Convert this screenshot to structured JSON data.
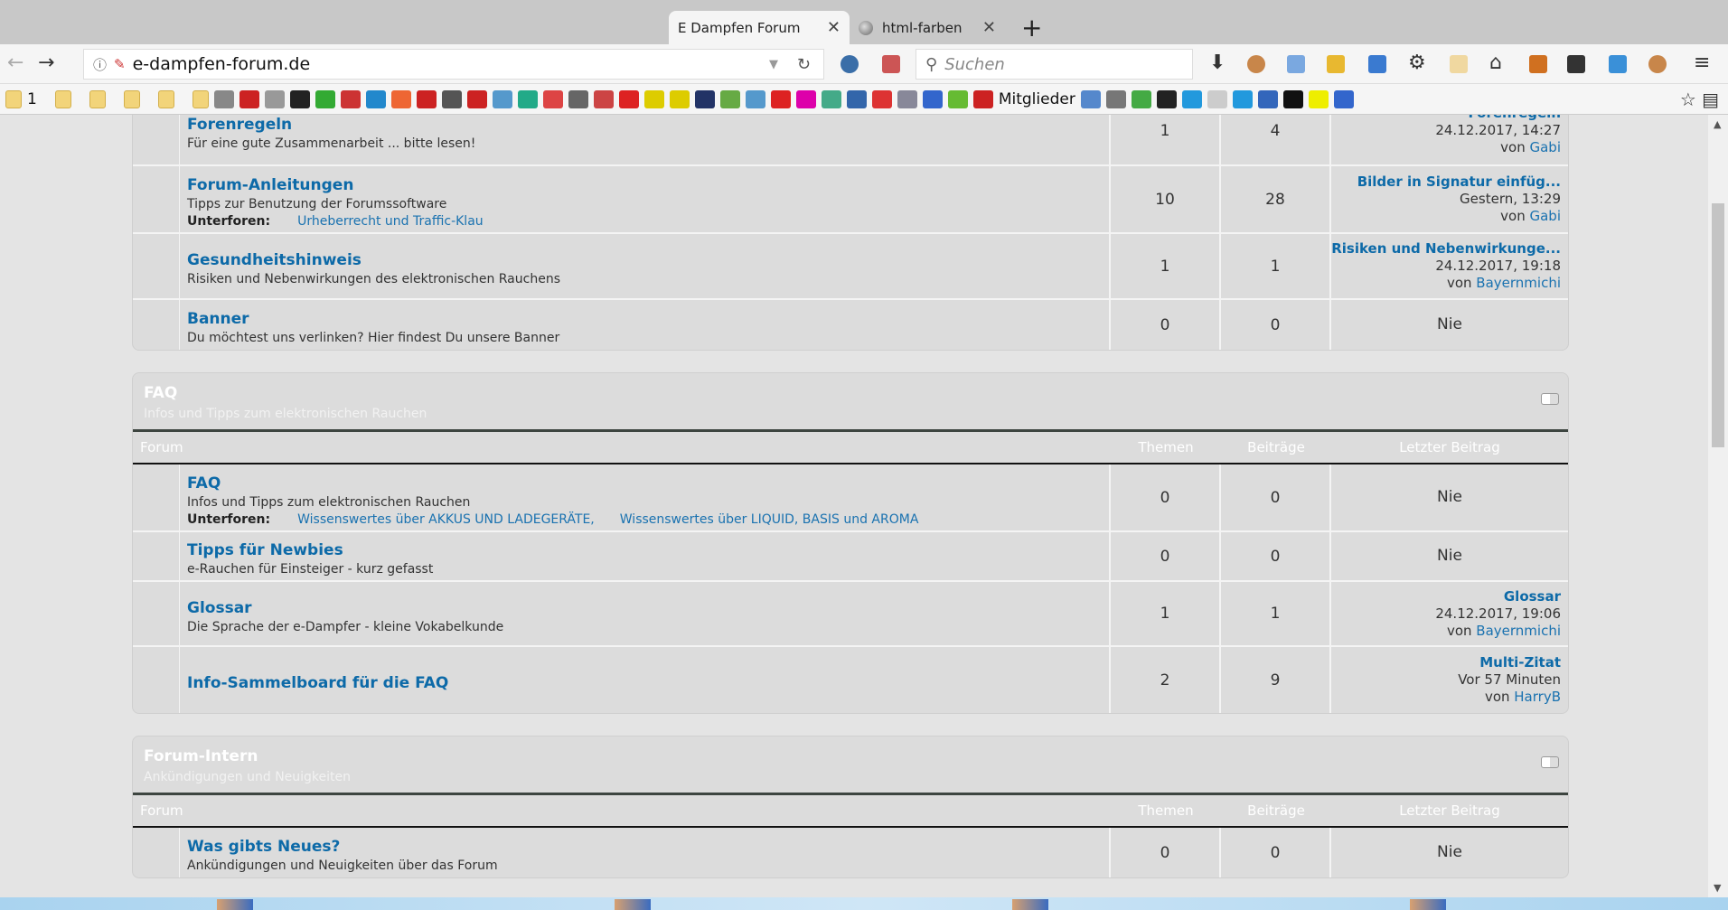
{
  "browser": {
    "tabs": [
      {
        "title": "E Dampfen Forum",
        "active": true
      },
      {
        "title": "html-farben",
        "active": false
      }
    ],
    "url": "e-dampfen-forum.de",
    "search_placeholder": "Suchen",
    "bookmarks": {
      "first_folder_label": "1",
      "members_label": "Mitglieder"
    }
  },
  "sections": [
    {
      "title": "",
      "description": "",
      "header_visible": false,
      "forums": [
        {
          "name": "Forenregeln",
          "description": "Für eine gute Zusammenarbeit ... bitte lesen!",
          "topics": "1",
          "posts": "4",
          "last_post": {
            "title": "Forenregeln",
            "time": "24.12.2017, 14:27",
            "by": "von",
            "author": "Gabi"
          }
        },
        {
          "name": "Forum-Anleitungen",
          "description": "Tipps zur Benutzung der Forumssoftware",
          "subforums_label": "Unterforen:",
          "subforums": [
            "Urheberrecht und Traffic-Klau"
          ],
          "topics": "10",
          "posts": "28",
          "last_post": {
            "title": "Bilder in Signatur einfüg...",
            "time": "Gestern, 13:29",
            "by": "von",
            "author": "Gabi"
          }
        },
        {
          "name": "Gesundheitshinweis",
          "description": "Risiken und Nebenwirkungen des elektronischen Rauchens",
          "topics": "1",
          "posts": "1",
          "last_post": {
            "title": "Risiken und Nebenwirkunge...",
            "time": "24.12.2017, 19:18",
            "by": "von",
            "author": "Bayernmichi"
          }
        },
        {
          "name": "Banner",
          "description": "Du möchtest uns verlinken? Hier findest Du unsere Banner",
          "topics": "0",
          "posts": "0",
          "never": "Nie"
        }
      ]
    },
    {
      "title": "FAQ",
      "description": "Infos und Tipps zum elektronischen Rauchen",
      "header_visible": true,
      "columns": {
        "forum": "Forum",
        "topics": "Themen",
        "posts": "Beiträge",
        "last": "Letzter Beitrag"
      },
      "forums": [
        {
          "name": "FAQ",
          "description": "Infos und Tipps zum elektronischen Rauchen",
          "subforums_label": "Unterforen:",
          "subforums": [
            "Wissenswertes über AKKUS UND LADEGERÄTE,",
            "Wissenswertes über LIQUID, BASIS und AROMA"
          ],
          "topics": "0",
          "posts": "0",
          "never": "Nie"
        },
        {
          "name": "Tipps für Newbies",
          "description": "e-Rauchen für Einsteiger - kurz gefasst",
          "topics": "0",
          "posts": "0",
          "never": "Nie"
        },
        {
          "name": "Glossar",
          "description": "Die Sprache der e-Dampfer - kleine Vokabelkunde",
          "topics": "1",
          "posts": "1",
          "last_post": {
            "title": "Glossar",
            "time": "24.12.2017, 19:06",
            "by": "von",
            "author": "Bayernmichi"
          }
        },
        {
          "name": "Info-Sammelboard für die FAQ",
          "description": "",
          "topics": "2",
          "posts": "9",
          "last_post": {
            "title": "Multi-Zitat",
            "time": "Vor 57 Minuten",
            "by": "von",
            "author": "HarryB"
          }
        }
      ]
    },
    {
      "title": "Forum-Intern",
      "description": "Ankündigungen und Neuigkeiten",
      "header_visible": true,
      "columns": {
        "forum": "Forum",
        "topics": "Themen",
        "posts": "Beiträge",
        "last": "Letzter Beitrag"
      },
      "forums": [
        {
          "name": "Was gibts Neues?",
          "description": "Ankündigungen und Neuigkeiten über das Forum",
          "topics": "0",
          "posts": "0",
          "never": "Nie"
        }
      ]
    }
  ],
  "colors": {
    "link": "#0d6aa8",
    "box_bg": "#dcdcdc",
    "header_line": "#3d4540"
  }
}
